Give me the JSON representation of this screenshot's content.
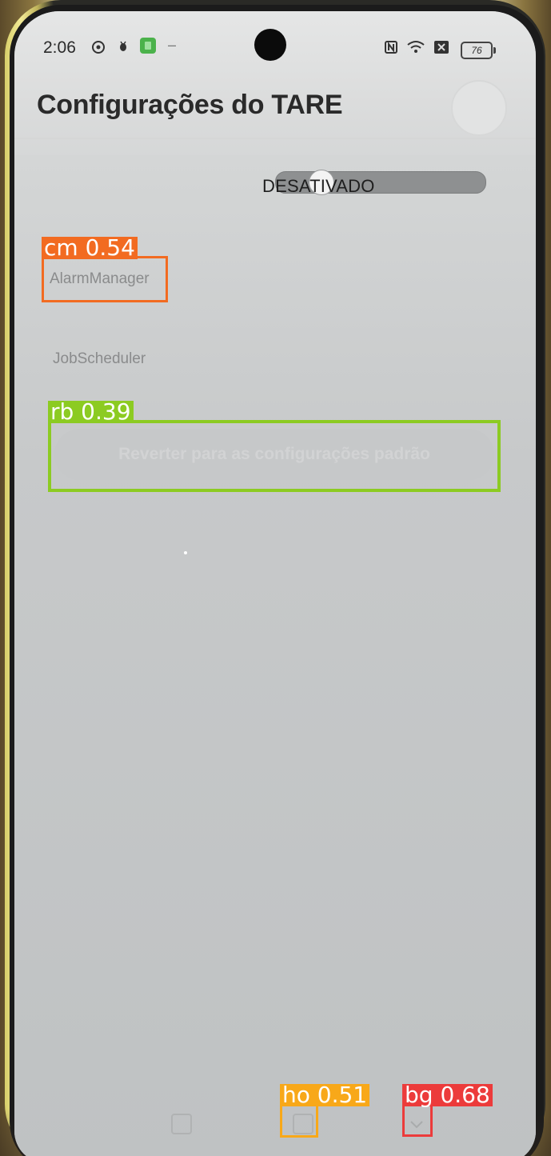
{
  "status_bar": {
    "time": "2:06",
    "battery": "76",
    "icons": [
      "vpn-icon",
      "bug-icon",
      "app-icon",
      "minus-icon",
      "nfc-icon",
      "wifi-icon",
      "sim-off-icon"
    ]
  },
  "header": {
    "title": "Configurações do TARE"
  },
  "toggle": {
    "label": "DESATIVADO",
    "state": "off"
  },
  "settings": {
    "items": [
      {
        "label": "AlarmManager"
      },
      {
        "label": "JobScheduler"
      }
    ]
  },
  "reset_button": {
    "label": "Reverter para as configurações padrão"
  },
  "detections": [
    {
      "label": "cm 0.54",
      "color": "#f26b21"
    },
    {
      "label": "rb 0.39",
      "color": "#8ccb22"
    },
    {
      "label": "ho 0.51",
      "color": "#f8a819"
    },
    {
      "label": "bg 0.68",
      "color": "#ec3b3b"
    }
  ],
  "colors": {
    "screen_bg": "#bcbfc1",
    "title_text": "#2a2a2a",
    "muted_text": "#8a8b8c"
  }
}
